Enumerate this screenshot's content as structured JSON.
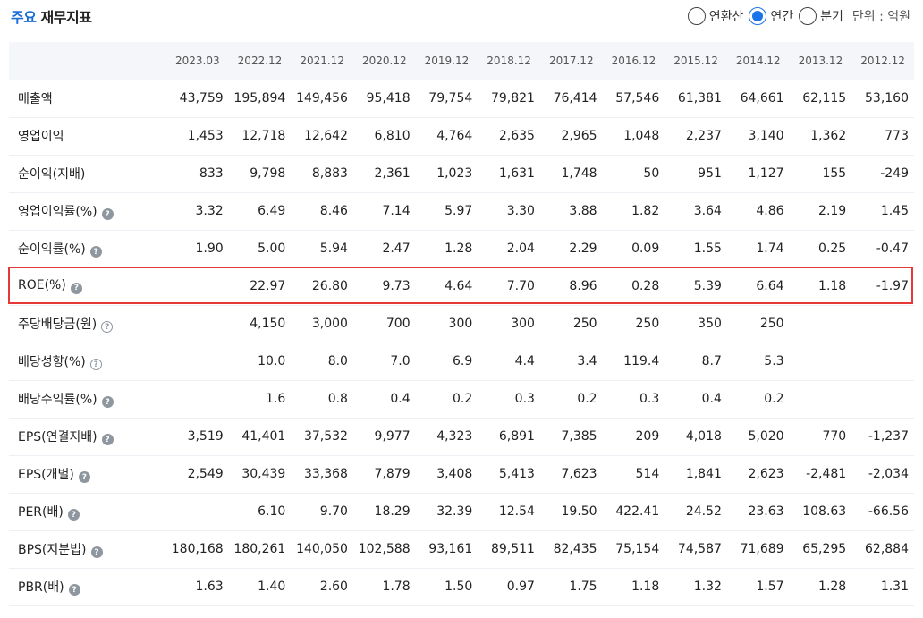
{
  "header": {
    "title_accent": "주요",
    "title_rest": "재무지표",
    "radio_options": [
      "연환산",
      "연간",
      "분기"
    ],
    "selected": "연간",
    "unit": "단위 : 억원"
  },
  "table": {
    "columns": [
      "2023.03",
      "2022.12",
      "2021.12",
      "2020.12",
      "2019.12",
      "2018.12",
      "2017.12",
      "2016.12",
      "2015.12",
      "2014.12",
      "2013.12",
      "2012.12"
    ],
    "rows": [
      {
        "label": "매출액",
        "help": "",
        "values": [
          "43,759",
          "195,894",
          "149,456",
          "95,418",
          "79,754",
          "79,821",
          "76,414",
          "57,546",
          "61,381",
          "64,661",
          "62,115",
          "53,160"
        ]
      },
      {
        "label": "영업이익",
        "help": "",
        "values": [
          "1,453",
          "12,718",
          "12,642",
          "6,810",
          "4,764",
          "2,635",
          "2,965",
          "1,048",
          "2,237",
          "3,140",
          "1,362",
          "773"
        ]
      },
      {
        "label": "순이익(지배)",
        "help": "",
        "values": [
          "833",
          "9,798",
          "8,883",
          "2,361",
          "1,023",
          "1,631",
          "1,748",
          "50",
          "951",
          "1,127",
          "155",
          "-249"
        ]
      },
      {
        "label": "영업이익률(%)",
        "help": "filled",
        "values": [
          "3.32",
          "6.49",
          "8.46",
          "7.14",
          "5.97",
          "3.30",
          "3.88",
          "1.82",
          "3.64",
          "4.86",
          "2.19",
          "1.45"
        ]
      },
      {
        "label": "순이익률(%)",
        "help": "filled",
        "values": [
          "1.90",
          "5.00",
          "5.94",
          "2.47",
          "1.28",
          "2.04",
          "2.29",
          "0.09",
          "1.55",
          "1.74",
          "0.25",
          "-0.47"
        ]
      },
      {
        "label": "ROE(%)",
        "help": "filled",
        "values": [
          "",
          "22.97",
          "26.80",
          "9.73",
          "4.64",
          "7.70",
          "8.96",
          "0.28",
          "5.39",
          "6.64",
          "1.18",
          "-1.97"
        ]
      },
      {
        "label": "주당배당금(원)",
        "help": "outline",
        "values": [
          "",
          "4,150",
          "3,000",
          "700",
          "300",
          "300",
          "250",
          "250",
          "350",
          "250",
          "",
          ""
        ]
      },
      {
        "label": "배당성향(%)",
        "help": "outline",
        "values": [
          "",
          "10.0",
          "8.0",
          "7.0",
          "6.9",
          "4.4",
          "3.4",
          "119.4",
          "8.7",
          "5.3",
          "",
          ""
        ]
      },
      {
        "label": "배당수익률(%)",
        "help": "filled",
        "values": [
          "",
          "1.6",
          "0.8",
          "0.4",
          "0.2",
          "0.3",
          "0.2",
          "0.3",
          "0.4",
          "0.2",
          "",
          ""
        ]
      },
      {
        "label": "EPS(연결지배)",
        "help": "filled",
        "values": [
          "3,519",
          "41,401",
          "37,532",
          "9,977",
          "4,323",
          "6,891",
          "7,385",
          "209",
          "4,018",
          "5,020",
          "770",
          "-1,237"
        ]
      },
      {
        "label": "EPS(개별)",
        "help": "filled",
        "values": [
          "2,549",
          "30,439",
          "33,368",
          "7,879",
          "3,408",
          "5,413",
          "7,623",
          "514",
          "1,841",
          "2,623",
          "-2,481",
          "-2,034"
        ]
      },
      {
        "label": "PER(배)",
        "help": "filled",
        "values": [
          "",
          "6.10",
          "9.70",
          "18.29",
          "32.39",
          "12.54",
          "19.50",
          "422.41",
          "24.52",
          "23.63",
          "108.63",
          "-66.56"
        ]
      },
      {
        "label": "BPS(지분법)",
        "help": "filled",
        "values": [
          "180,168",
          "180,261",
          "140,050",
          "102,588",
          "93,161",
          "89,511",
          "82,435",
          "75,154",
          "74,587",
          "71,689",
          "65,295",
          "62,884"
        ]
      },
      {
        "label": "PBR(배)",
        "help": "filled",
        "values": [
          "1.63",
          "1.40",
          "2.60",
          "1.78",
          "1.50",
          "0.97",
          "1.75",
          "1.18",
          "1.32",
          "1.57",
          "1.28",
          "1.31"
        ]
      }
    ]
  },
  "highlight_row_label": "ROE(%)",
  "colors": {
    "accent": "#1a6dd6",
    "radio": "#1a73e8",
    "highlight": "#e53935",
    "header_bg": "#f4f6f9"
  },
  "icons": {
    "help": "question-circle-icon"
  }
}
